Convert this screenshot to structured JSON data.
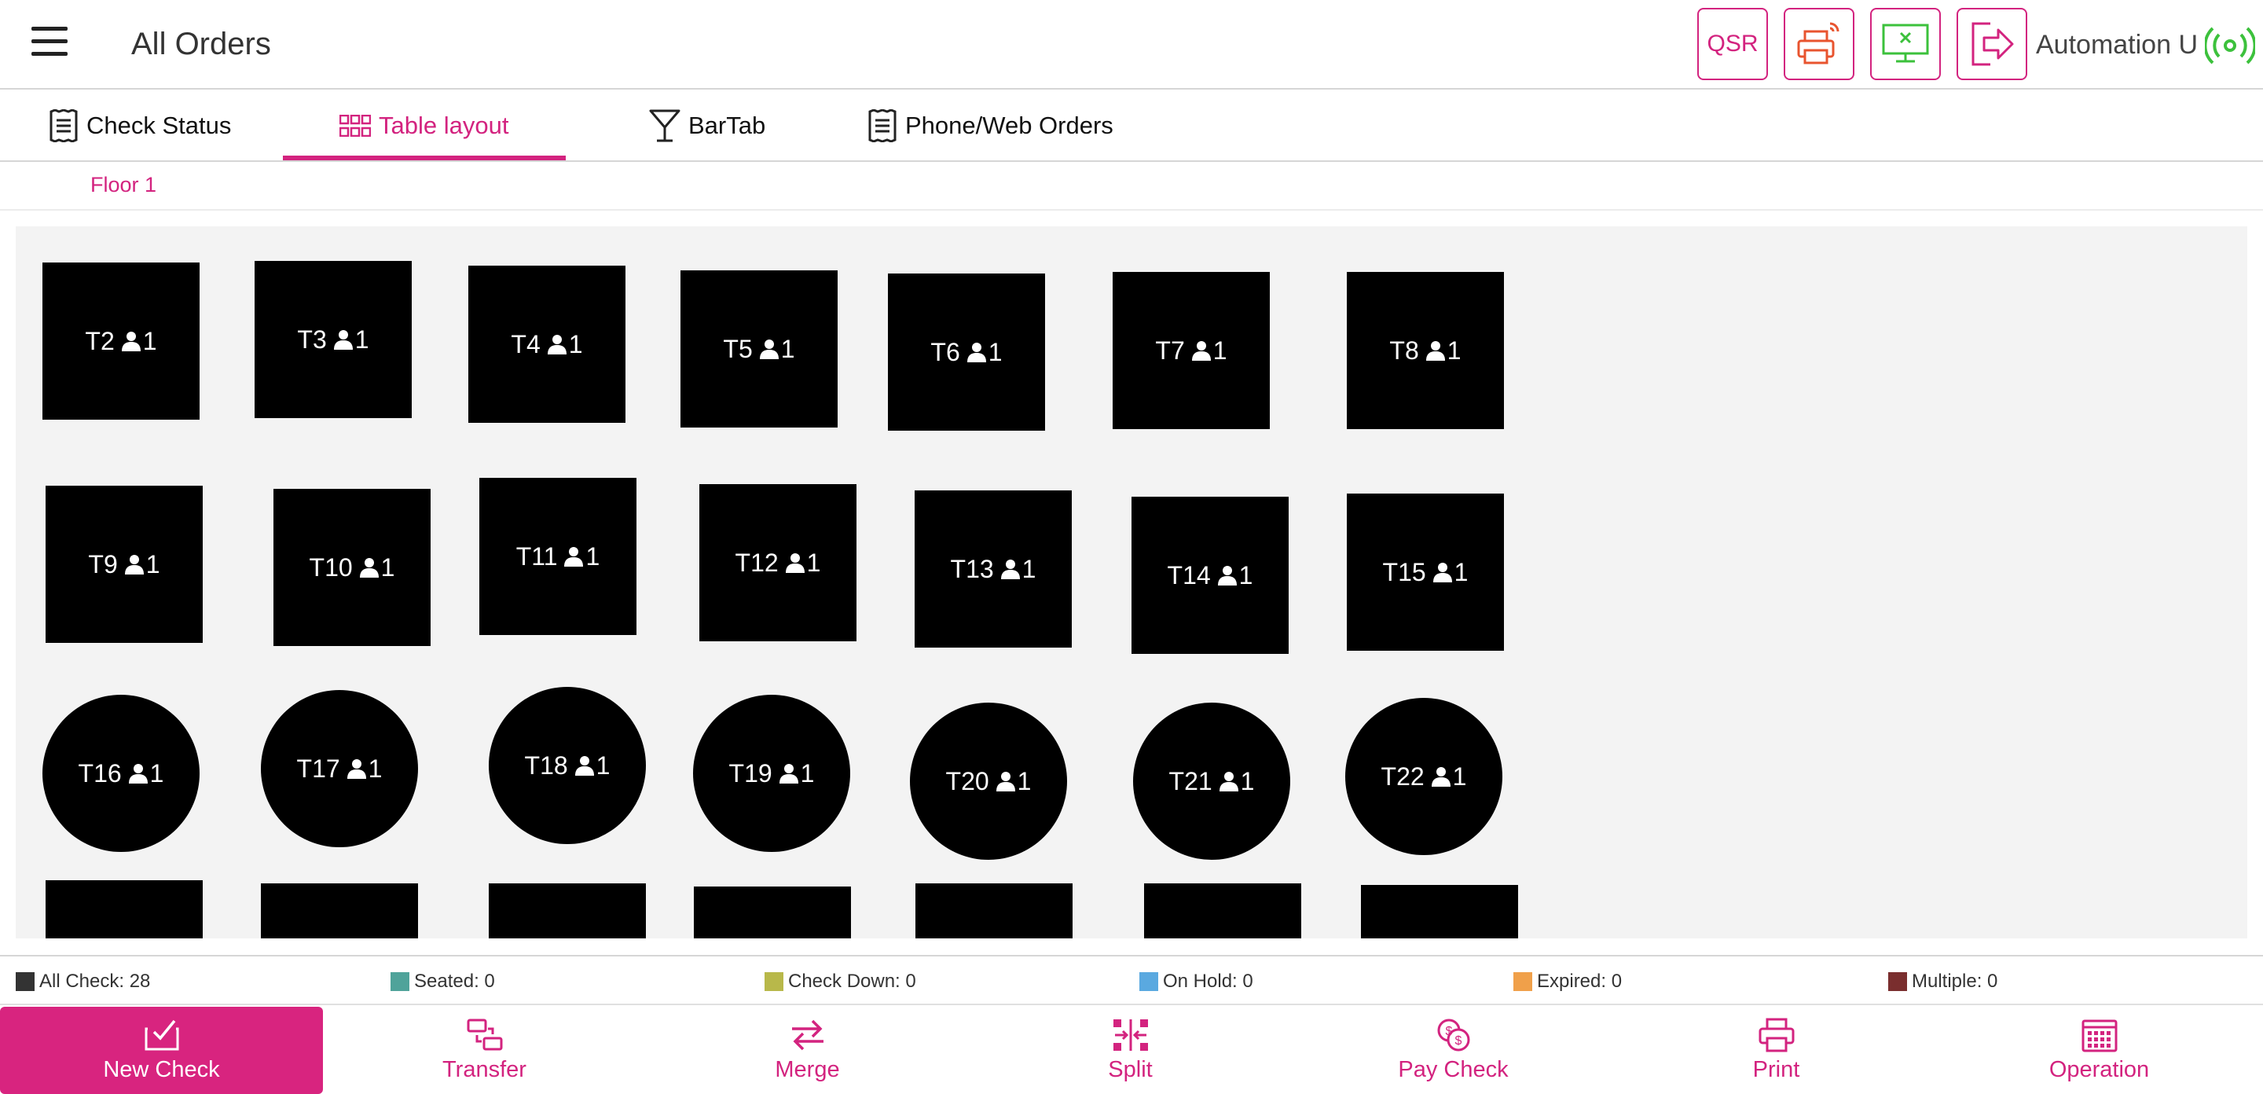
{
  "header": {
    "title": "All Orders",
    "qsr_label": "QSR",
    "user": "Automation U",
    "icons": [
      "menu-icon",
      "printer-icon",
      "display-sync-icon",
      "logout-icon",
      "connection-signal-icon"
    ]
  },
  "tabs": [
    {
      "label": "Check Status",
      "icon": "receipt-icon"
    },
    {
      "label": "Table layout",
      "icon": "grid-icon",
      "active": true
    },
    {
      "label": "BarTab",
      "icon": "cocktail-icon"
    },
    {
      "label": "Phone/Web Orders",
      "icon": "receipt-icon"
    }
  ],
  "floor": "Floor 1",
  "tables": [
    {
      "name": "T2",
      "guests": "1",
      "shape": "square"
    },
    {
      "name": "T3",
      "guests": "1",
      "shape": "square"
    },
    {
      "name": "T4",
      "guests": "1",
      "shape": "square"
    },
    {
      "name": "T5",
      "guests": "1",
      "shape": "square"
    },
    {
      "name": "T6",
      "guests": "1",
      "shape": "square"
    },
    {
      "name": "T7",
      "guests": "1",
      "shape": "square"
    },
    {
      "name": "T8",
      "guests": "1",
      "shape": "square"
    },
    {
      "name": "T9",
      "guests": "1",
      "shape": "square"
    },
    {
      "name": "T10",
      "guests": "1",
      "shape": "square"
    },
    {
      "name": "T11",
      "guests": "1",
      "shape": "square"
    },
    {
      "name": "T12",
      "guests": "1",
      "shape": "square"
    },
    {
      "name": "T13",
      "guests": "1",
      "shape": "square"
    },
    {
      "name": "T14",
      "guests": "1",
      "shape": "square"
    },
    {
      "name": "T15",
      "guests": "1",
      "shape": "square"
    },
    {
      "name": "T16",
      "guests": "1",
      "shape": "round"
    },
    {
      "name": "T17",
      "guests": "1",
      "shape": "round"
    },
    {
      "name": "T18",
      "guests": "1",
      "shape": "round"
    },
    {
      "name": "T19",
      "guests": "1",
      "shape": "round"
    },
    {
      "name": "T20",
      "guests": "1",
      "shape": "round"
    },
    {
      "name": "T21",
      "guests": "1",
      "shape": "round"
    },
    {
      "name": "T22",
      "guests": "1",
      "shape": "round"
    }
  ],
  "status": [
    {
      "label": "All Check: 28",
      "color": "#333333"
    },
    {
      "label": "Seated: 0",
      "color": "#4fa39a"
    },
    {
      "label": "Check Down: 0",
      "color": "#b8b84a"
    },
    {
      "label": "On Hold: 0",
      "color": "#5aa9e0"
    },
    {
      "label": "Expired: 0",
      "color": "#f0a04a"
    },
    {
      "label": "Multiple: 0",
      "color": "#7a2e2e"
    }
  ],
  "footer": [
    {
      "label": "New Check",
      "icon": "new-check-icon"
    },
    {
      "label": "Transfer",
      "icon": "transfer-icon"
    },
    {
      "label": "Merge",
      "icon": "merge-icon"
    },
    {
      "label": "Split",
      "icon": "split-icon"
    },
    {
      "label": "Pay Check",
      "icon": "pay-check-icon"
    },
    {
      "label": "Print",
      "icon": "print-icon"
    },
    {
      "label": "Operation",
      "icon": "calendar-icon"
    }
  ],
  "colors": {
    "accent": "#d3237f",
    "table": "#000000",
    "canvas": "#f3f3f3"
  }
}
